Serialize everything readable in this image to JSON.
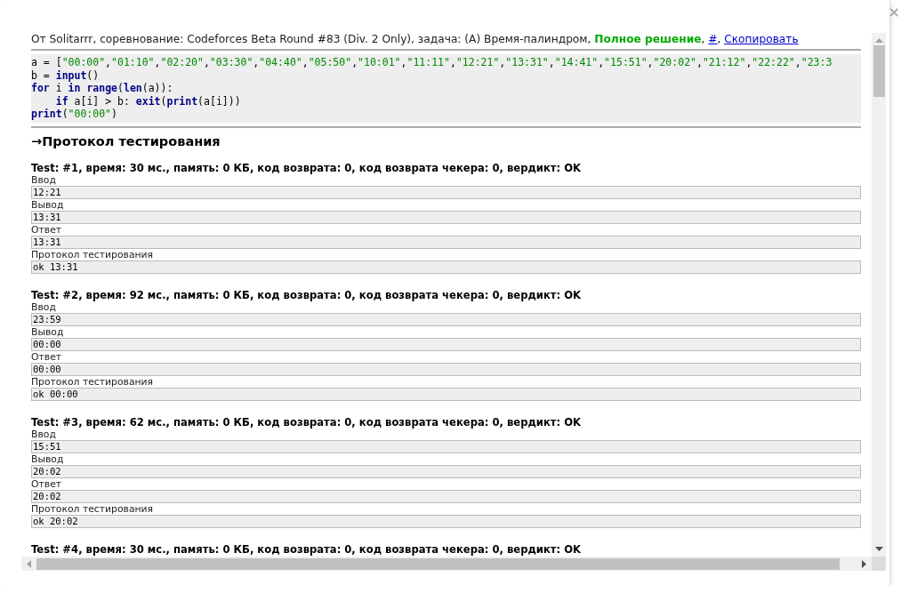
{
  "close_button": "×",
  "header": [
    {
      "kind": "text",
      "text": "От Solitarrr, соревнование: Codeforces Beta Round #83 (Div. 2 Only), задача: (A) Время-палиндром,"
    },
    {
      "kind": "verdict",
      "text": "Полное решение"
    },
    {
      "kind": "punct",
      "text": ","
    },
    {
      "kind": "link",
      "text": "#"
    },
    {
      "kind": "punct",
      "text": ","
    },
    {
      "kind": "link",
      "text": "Скопировать"
    }
  ],
  "code": [
    "a = [\"00:00\",\"01:10\",\"02:20\",\"03:30\",\"04:40\",\"05:50\",\"10:01\",\"11:11\",\"12:21\",\"13:31\",\"14:41\",\"15:51\",\"20:02\",\"21:12\",\"22:22\",\"23:3",
    "b = input()",
    "for i in range(len(a)):",
    "    if a[i] > b: exit(print(a[i]))",
    "print(\"00:00\")"
  ],
  "protocol_heading": "→Протокол тестирования",
  "tests": [
    {
      "title": "Test: #1, время: 30 мс., память: 0 КБ, код возврата: 0, код возврата чекера: 0, вердикт: OK",
      "fields": [
        {
          "label": "Ввод",
          "value": "12:21"
        },
        {
          "label": "Вывод",
          "value": "13:31"
        },
        {
          "label": "Ответ",
          "value": "13:31"
        },
        {
          "label": "Протокол тестирования",
          "value": "ok 13:31"
        }
      ]
    },
    {
      "title": "Test: #2, время: 92 мс., память: 0 КБ, код возврата: 0, код возврата чекера: 0, вердикт: OK",
      "fields": [
        {
          "label": "Ввод",
          "value": "23:59"
        },
        {
          "label": "Вывод",
          "value": "00:00"
        },
        {
          "label": "Ответ",
          "value": "00:00"
        },
        {
          "label": "Протокол тестирования",
          "value": "ok 00:00"
        }
      ]
    },
    {
      "title": "Test: #3, время: 62 мс., память: 0 КБ, код возврата: 0, код возврата чекера: 0, вердикт: OK",
      "fields": [
        {
          "label": "Ввод",
          "value": "15:51"
        },
        {
          "label": "Вывод",
          "value": "20:02"
        },
        {
          "label": "Ответ",
          "value": "20:02"
        },
        {
          "label": "Протокол тестирования",
          "value": "ok 20:02"
        }
      ]
    },
    {
      "title": "Test: #4, время: 30 мс., память: 0 КБ, код возврата: 0, код возврата чекера: 0, вердикт: OK"
    }
  ]
}
